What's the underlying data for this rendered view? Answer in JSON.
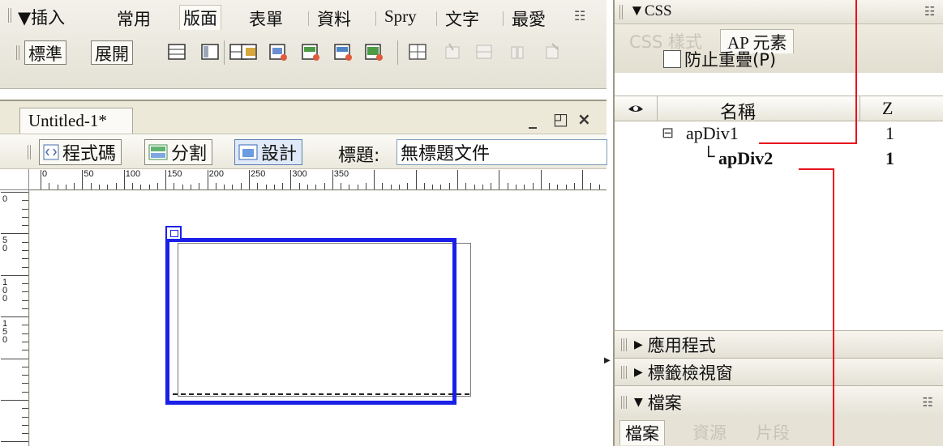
{
  "insert_bar": {
    "title": "插入",
    "tabs": [
      "常用",
      "版面",
      "表單",
      "資料",
      "Spry",
      "文字",
      "最愛"
    ],
    "active_tab": "版面",
    "toggle_buttons": [
      "標準",
      "展開"
    ]
  },
  "document": {
    "tab_label": "Untitled-1*",
    "minimize": "_",
    "restore": "ꟸ",
    "close": "×",
    "view_buttons": [
      "程式碼",
      "分割",
      "設計"
    ],
    "active_view": "設計",
    "title_label": "標題:",
    "title_value": "無標題文件",
    "ruler_h_labels": [
      "0",
      "50",
      "100",
      "150",
      "200",
      "250",
      "300",
      "350"
    ],
    "ruler_v_labels": [
      "0",
      "50",
      "100",
      "150"
    ]
  },
  "css_panel": {
    "title": "CSS",
    "tabs": [
      "CSS 樣式",
      "AP 元素"
    ],
    "active_tab": "AP 元素",
    "prevent_overlap": "防止重疊(P)",
    "columns": {
      "visibility_icon": "eye-icon",
      "name": "名稱",
      "z": "Z"
    },
    "rows": [
      {
        "name": "apDiv1",
        "z": "1",
        "expander": "⊟"
      },
      {
        "name": "apDiv2",
        "z": "1",
        "connector": "└"
      }
    ]
  },
  "collapsed_panels": [
    "應用程式",
    "標籤檢視窗"
  ],
  "files_panel": {
    "title": "檔案",
    "tabs": [
      "檔案",
      "資源",
      "片段"
    ]
  },
  "colors": {
    "apdiv_border": "#1a20e8",
    "callout_red": "#e8121e"
  }
}
